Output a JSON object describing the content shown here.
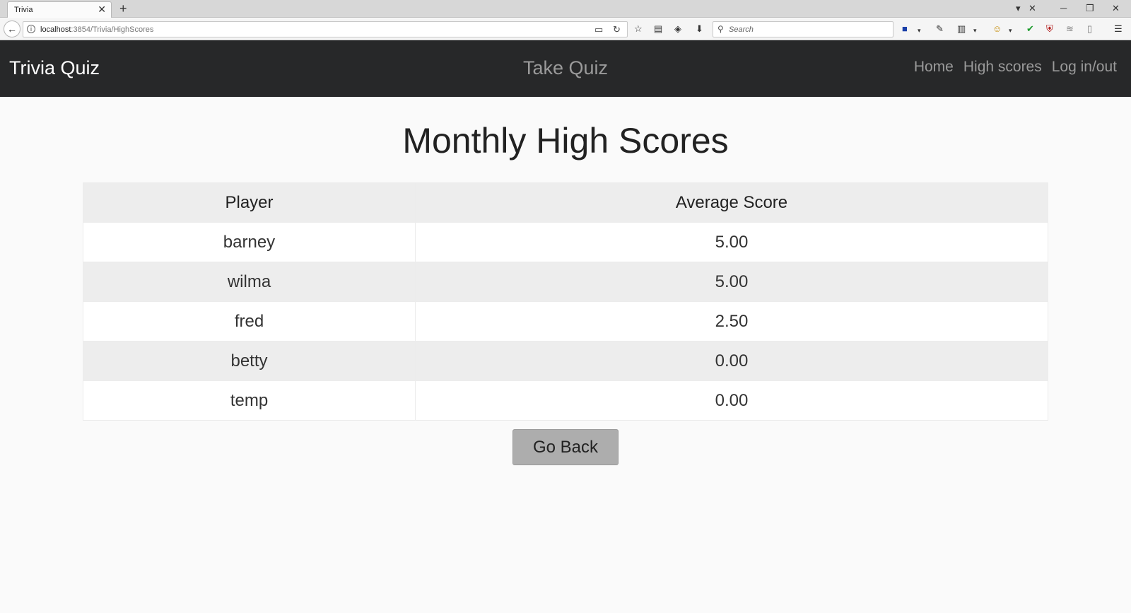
{
  "browser": {
    "tab_title": "Trivia",
    "tab_close": "✕",
    "new_tab": "+",
    "url_host": "localhost",
    "url_path": ":3854/Trivia/HighScores",
    "search_placeholder": "Search"
  },
  "nav": {
    "brand": "Trivia Quiz",
    "center_link": "Take Quiz",
    "links": [
      "Home",
      "High scores",
      "Log in/out"
    ]
  },
  "main": {
    "title": "Monthly High Scores",
    "table": {
      "headers": [
        "Player",
        "Average Score"
      ],
      "rows": [
        [
          "barney",
          "5.00"
        ],
        [
          "wilma",
          "5.00"
        ],
        [
          "fred",
          "2.50"
        ],
        [
          "betty",
          "0.00"
        ],
        [
          "temp",
          "0.00"
        ]
      ]
    },
    "back_button": "Go Back"
  },
  "colors": {
    "navbar_bg": "#272829",
    "page_bg": "#fafafa",
    "button_bg": "#adadad"
  }
}
